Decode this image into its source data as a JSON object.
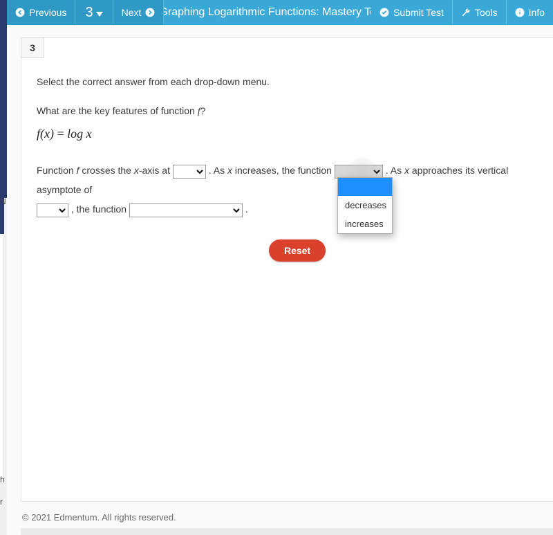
{
  "topbar": {
    "previous": "Previous",
    "question_nav_number": "3",
    "next": "Next",
    "title": "Graphing Logarithmic Functions: Mastery Te",
    "submit": "Submit Test",
    "tools": "Tools",
    "info": "Info"
  },
  "question": {
    "number": "3",
    "instruction": "Select the correct answer from each drop-down menu.",
    "prompt_pre": "What are the key features of function ",
    "prompt_f": "f",
    "prompt_post": "?",
    "formula_lhs": "f(x)",
    "formula_eq": " = ",
    "formula_rhs": "log x",
    "s1_a": "Function ",
    "s1_f": "f",
    "s1_b": " crosses the ",
    "s1_x": "x",
    "s1_c": "-axis at ",
    "s1_d": " . As ",
    "s1_x2": "x",
    "s1_e": " increases, the function ",
    "s1_f2": " . As ",
    "s1_x3": "x",
    "s1_g": " approaches its vertical asymptote of",
    "s2_a": " , the function ",
    "s2_b": " .",
    "reset": "Reset"
  },
  "dropdown": {
    "options": [
      "",
      "decreases",
      "increases"
    ]
  },
  "footer": {
    "copyright": "© 2021 Edmentum. All rights reserved."
  }
}
